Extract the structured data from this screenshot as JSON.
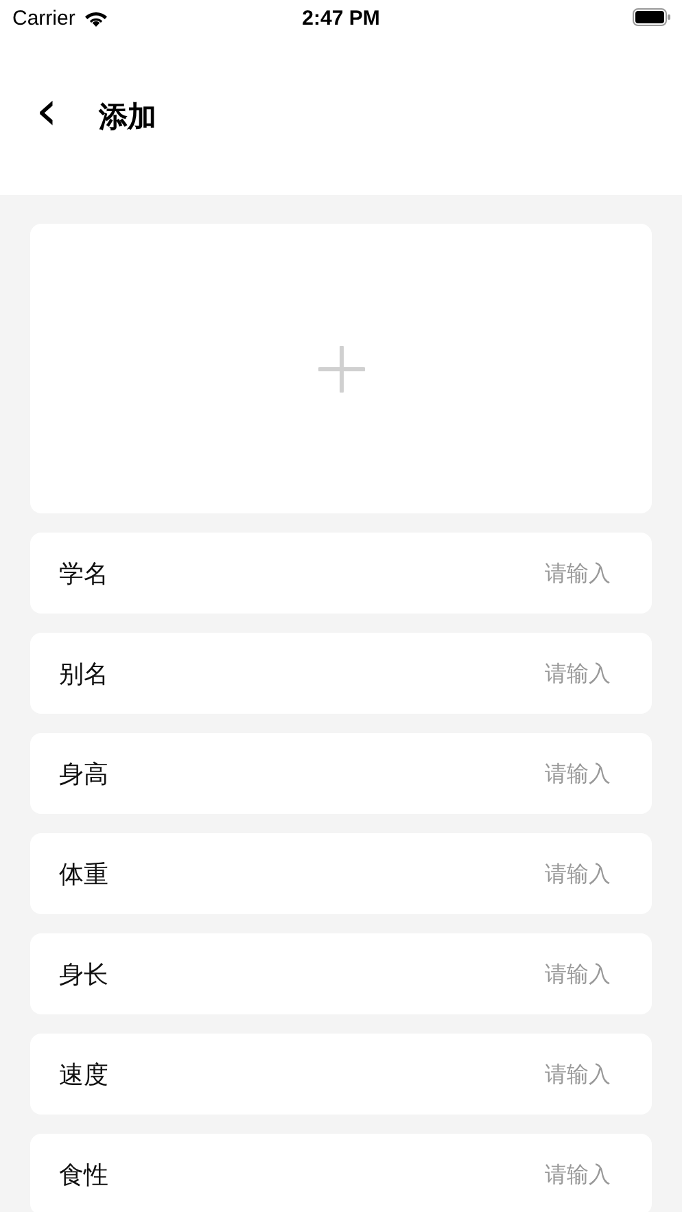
{
  "status_bar": {
    "carrier": "Carrier",
    "time": "2:47 PM"
  },
  "header": {
    "back": "‹",
    "title": "添加"
  },
  "fields": [
    {
      "label": "学名",
      "placeholder": "请输入"
    },
    {
      "label": "别名",
      "placeholder": "请输入"
    },
    {
      "label": "身高",
      "placeholder": "请输入"
    },
    {
      "label": "体重",
      "placeholder": "请输入"
    },
    {
      "label": "身长",
      "placeholder": "请输入"
    },
    {
      "label": "速度",
      "placeholder": "请输入"
    },
    {
      "label": "食性",
      "placeholder": "请输入"
    }
  ]
}
